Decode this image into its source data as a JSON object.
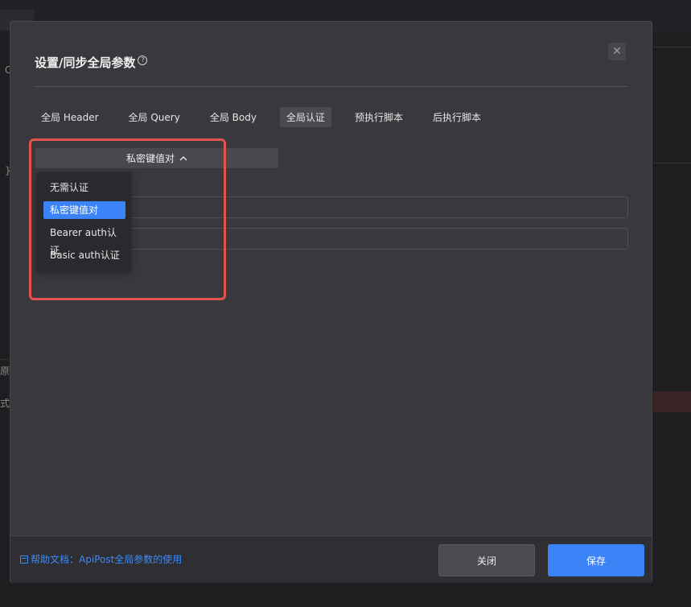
{
  "background": {
    "left_char_1": "C",
    "brace": "}",
    "left_char_2": "原生",
    "left_char_3": "式:"
  },
  "modal": {
    "title": "设置/同步全局参数",
    "help_icon_glyph": "?",
    "close_glyph": "✕",
    "tabs": [
      {
        "label": "全局 Header",
        "active": false
      },
      {
        "label": "全局 Query",
        "active": false
      },
      {
        "label": "全局 Body",
        "active": false
      },
      {
        "label": "全局认证",
        "active": true
      },
      {
        "label": "预执行脚本",
        "active": false
      },
      {
        "label": "后执行脚本",
        "active": false
      }
    ],
    "auth_select": {
      "selected": "私密键值对"
    },
    "dropdown": {
      "options": [
        {
          "label": "无需认证",
          "selected": false
        },
        {
          "label": "私密键值对",
          "selected": true
        },
        {
          "label": "Bearer auth认证",
          "selected": false
        },
        {
          "label": "Basic auth认证",
          "selected": false
        }
      ]
    },
    "footer": {
      "help_link": "帮助文档：ApiPost全局参数的使用",
      "close_label": "关闭",
      "save_label": "保存"
    }
  },
  "colors": {
    "accent": "#3b83f6",
    "highlight": "#e3524d"
  }
}
